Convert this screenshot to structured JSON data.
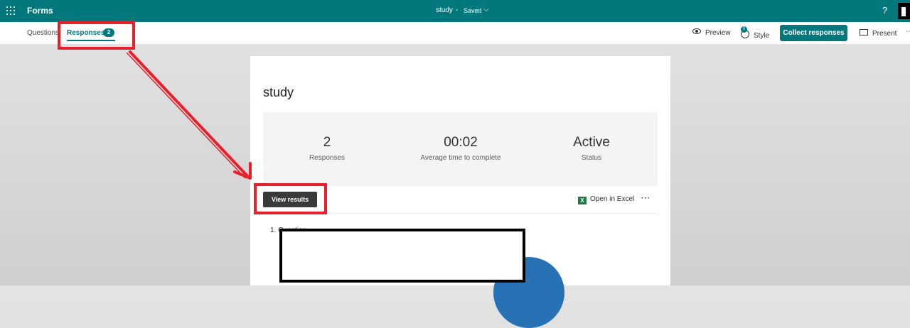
{
  "topbar": {
    "app_name": "Forms",
    "doc_title": "study",
    "separator": "-",
    "doc_status": "Saved",
    "chevron": "⌵",
    "help": "?",
    "icons": [
      "waffle-icon",
      "chevron-down-icon",
      "help-icon"
    ]
  },
  "commandbar": {
    "tabs": [
      {
        "label": "Questions",
        "selected": false
      },
      {
        "label": "Responses",
        "selected": true,
        "badge": "2"
      }
    ],
    "preview_label": "Preview",
    "style_label": "Style",
    "style_badge": "0",
    "collect_label": "Collect responses",
    "present_label": "Present",
    "more": "⋯",
    "icons": [
      "eye-icon",
      "palette-icon",
      "monitor-icon"
    ]
  },
  "form": {
    "title": "study",
    "stats": [
      {
        "value": "2",
        "label": "Responses"
      },
      {
        "value": "00:02",
        "label": "Average time to complete"
      },
      {
        "value": "Active",
        "label": "Status"
      }
    ],
    "view_results_label": "View results",
    "open_excel_label": "Open in Excel",
    "excel_icon_glyph": "X",
    "more": "···",
    "question_label": "1. Question"
  },
  "colors": {
    "brand": "#03787c",
    "annotation": "#e8202a",
    "pie": "#2672b4",
    "button_dark": "#3b3a39"
  }
}
